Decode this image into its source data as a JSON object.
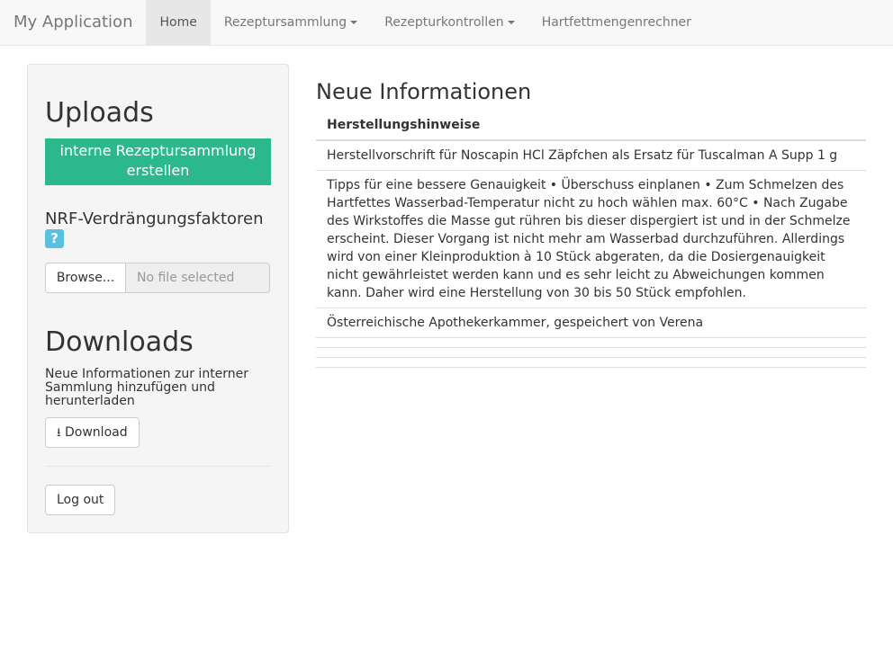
{
  "nav": {
    "brand": "My Application",
    "items": [
      "Home",
      "Rezeptursammlung",
      "Rezepturkontrollen",
      "Hartfettmengenrechner"
    ]
  },
  "sidebar": {
    "uploads_title": "Uploads",
    "create_button": "interne Rezeptursammlung erstellen",
    "nrf_label": "NRF-Verdrängungsfaktoren",
    "help": "?",
    "browse": "Browse...",
    "file_placeholder": "No file selected",
    "downloads_title": "Downloads",
    "downloads_desc": "Neue Informationen zur interner Sammlung hinzufügen und herunterladen",
    "download_button": "Download",
    "logout_button": "Log out"
  },
  "main": {
    "title": "Neue Informationen",
    "header": "Herstellungshinweise",
    "rows": [
      "Herstellvorschrift für Noscapin HCl Zäpfchen als Ersatz für Tuscalman A Supp 1 g",
      "Tipps für eine bessere Genauigkeit • Überschuss einplanen • Zum Schmelzen des Hartfettes Wasserbad-Temperatur nicht zu hoch wählen max. 60°C • Nach Zugabe des Wirkstoffes die Masse gut rühren bis dieser dispergiert ist und in der Schmelze erscheint. Dieser Vorgang ist nicht mehr am Wasserbad durchzuführen. Allerdings wird von einer Kleinproduktion à 10 Stück abgeraten, da die Dosiergenauigkeit nicht gewährleistet werden kann und es sehr leicht zu Abweichungen kommen kann. Daher wird eine Herstellung von 30 bis 50 Stück empfohlen.",
      "Österreichische Apothekerkammer, gespeichert von Verena"
    ]
  }
}
